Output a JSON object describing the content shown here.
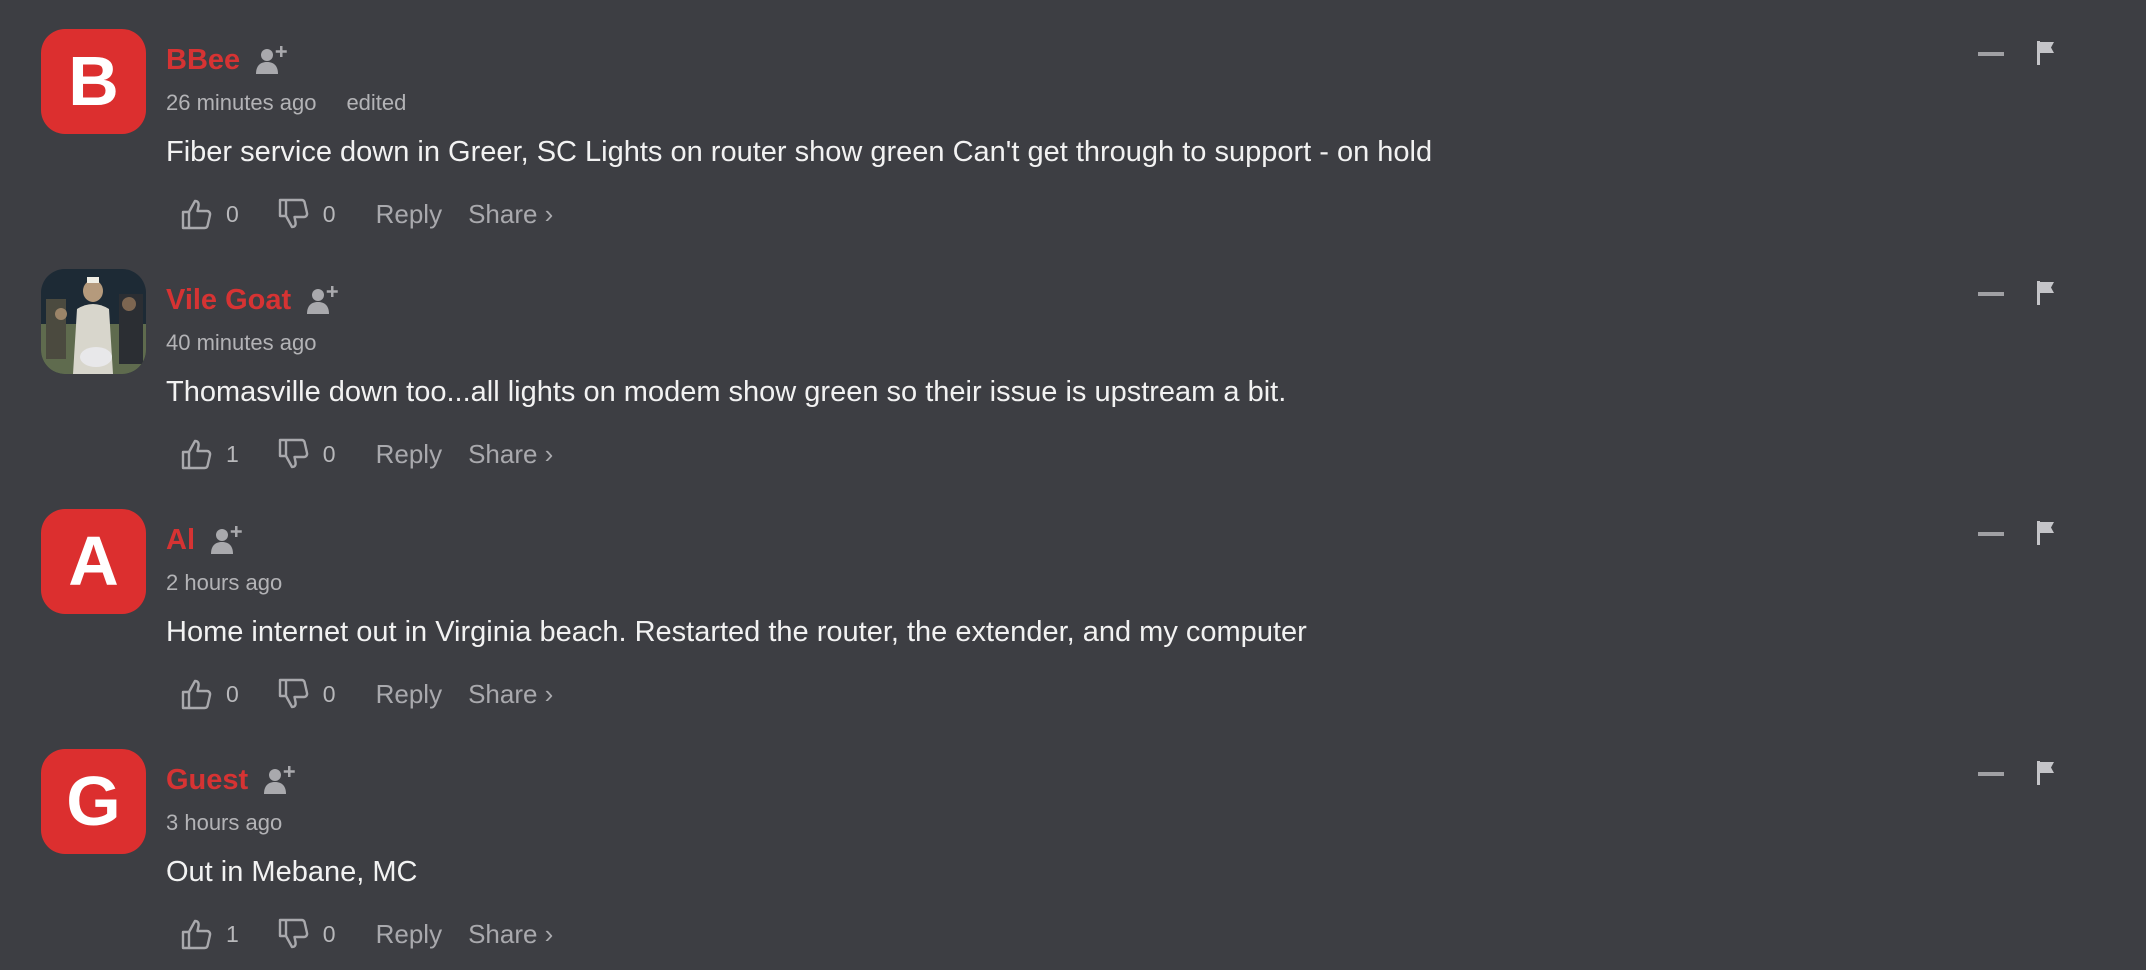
{
  "comments": [
    {
      "avatar_letter": "B",
      "avatar_type": "letter",
      "author": "BBee",
      "time": "26 minutes ago",
      "edited": "edited",
      "text": "Fiber service down in Greer, SC Lights on router show green Can't get through to support - on hold",
      "likes": "0",
      "dislikes": "0",
      "reply_label": "Reply",
      "share_label": "Share ›"
    },
    {
      "avatar_letter": "",
      "avatar_type": "photo",
      "author": "Vile Goat",
      "time": "40 minutes ago",
      "edited": "",
      "text": "Thomasville down too...all lights on modem show green so their issue is upstream a bit.",
      "likes": "1",
      "dislikes": "0",
      "reply_label": "Reply",
      "share_label": "Share ›"
    },
    {
      "avatar_letter": "A",
      "avatar_type": "letter",
      "author": "Al",
      "time": "2 hours ago",
      "edited": "",
      "text": "Home internet out in Virginia beach. Restarted the router, the extender, and my computer",
      "likes": "0",
      "dislikes": "0",
      "reply_label": "Reply",
      "share_label": "Share ›"
    },
    {
      "avatar_letter": "G",
      "avatar_type": "letter",
      "author": "Guest",
      "time": "3 hours ago",
      "edited": "",
      "text": "Out in Mebane, MC",
      "likes": "1",
      "dislikes": "0",
      "reply_label": "Reply",
      "share_label": "Share ›"
    }
  ],
  "colors": {
    "background": "#3d3e43",
    "avatar_red": "#dc2f2f",
    "author_red": "#d63333",
    "muted": "#a9a9ad",
    "text": "#f2f2f2"
  },
  "icons": {
    "follow": "person-plus-icon",
    "like": "thumbs-up-icon",
    "dislike": "thumbs-down-icon",
    "collapse": "minus-icon",
    "flag": "flag-icon"
  }
}
